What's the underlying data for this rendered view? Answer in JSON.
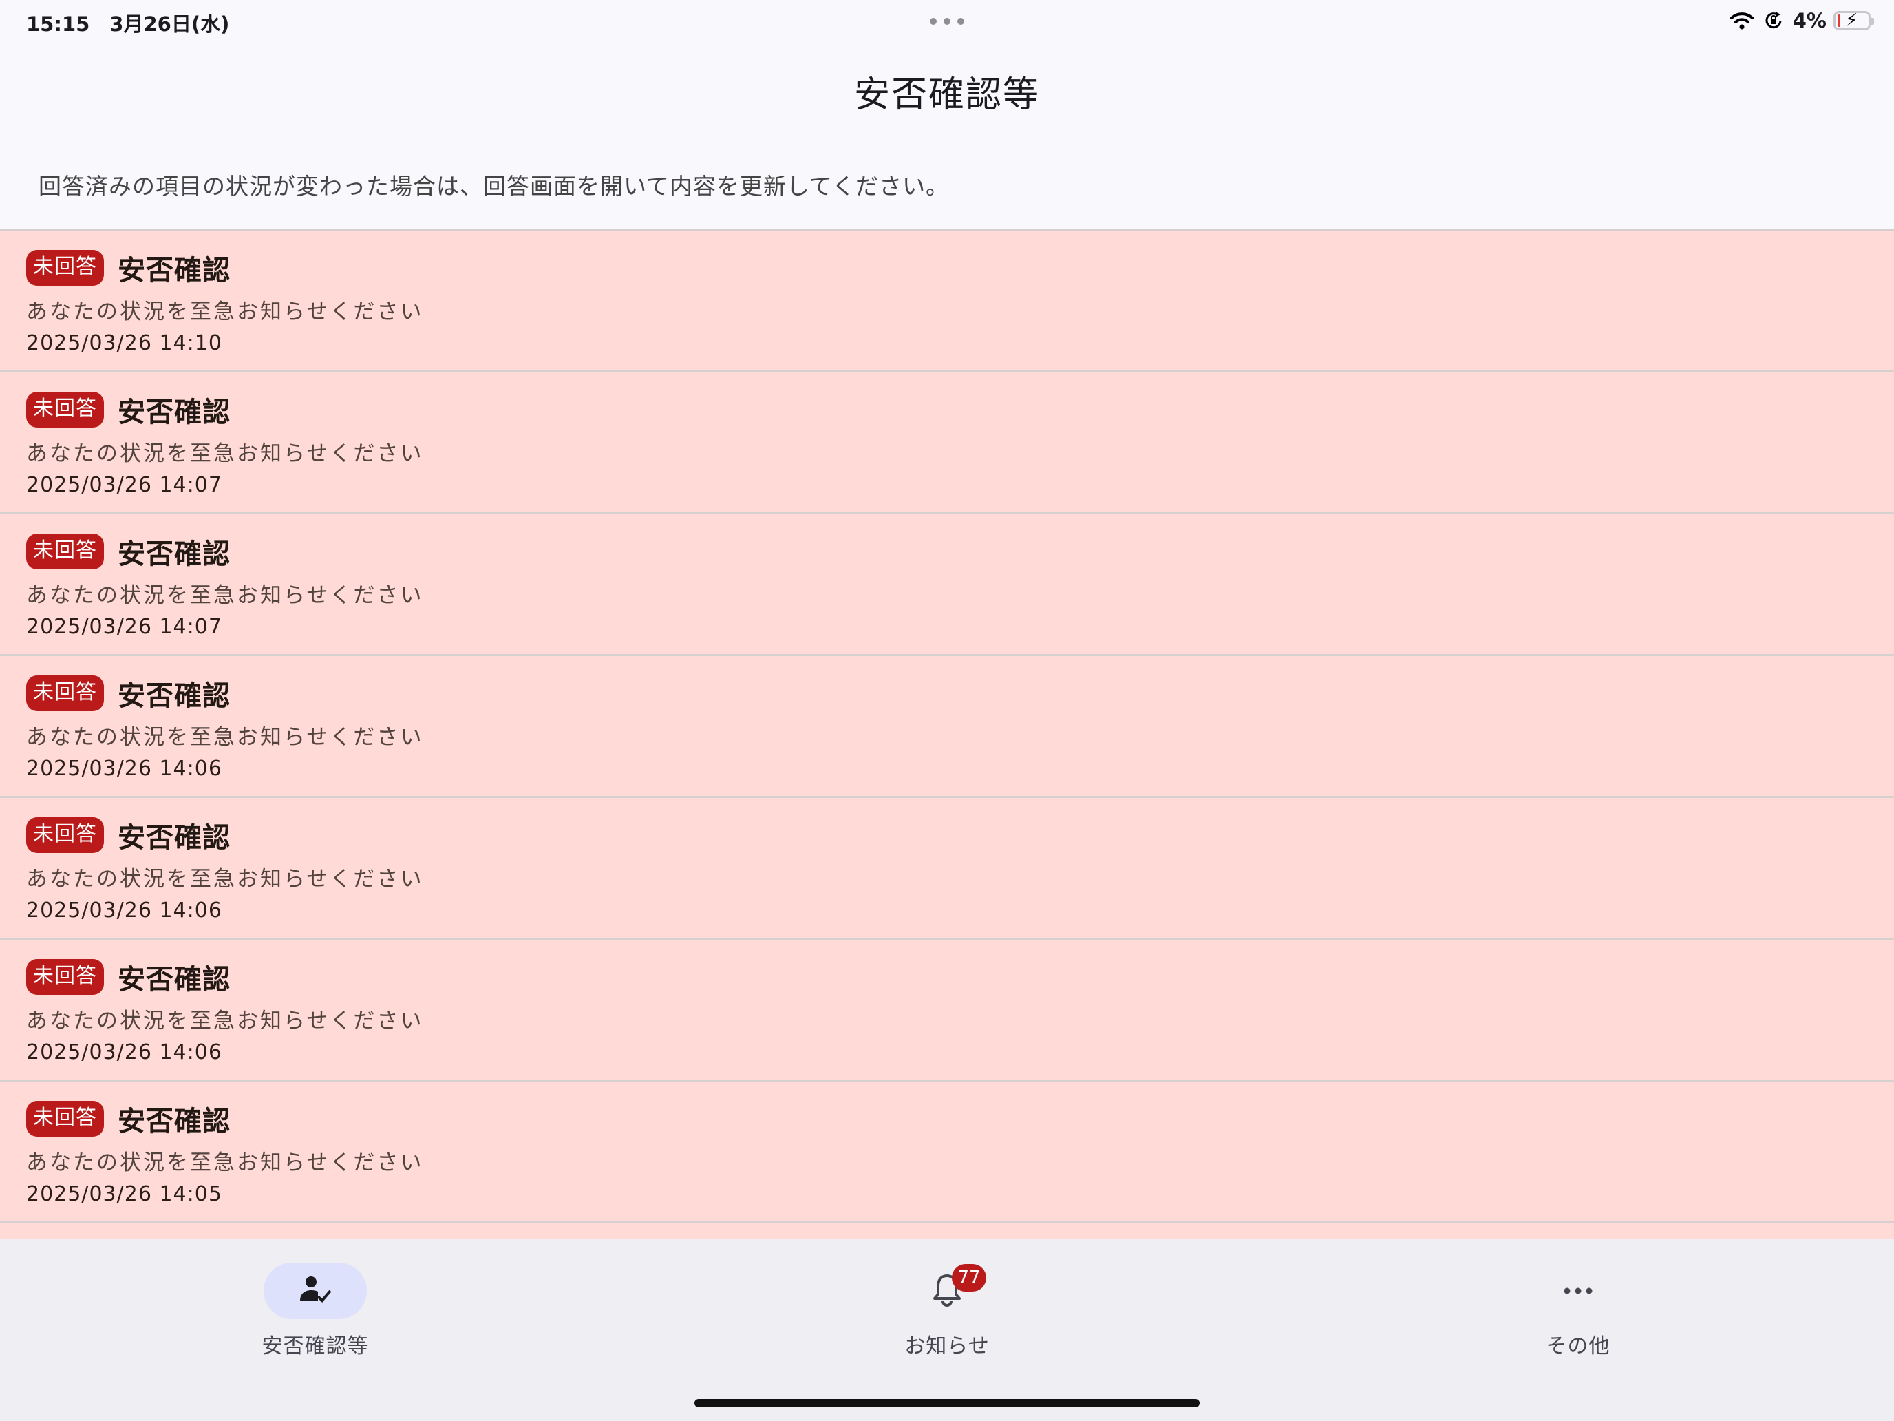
{
  "status_bar": {
    "time": "15:15　3月26日(水)",
    "battery_percent": "4%",
    "icons": [
      "wifi-icon",
      "orientation-lock-icon",
      "battery-icon"
    ]
  },
  "header": {
    "title": "安否確認等"
  },
  "notice": "回答済みの項目の状況が変わった場合は、回答画面を開いて内容を更新してください。",
  "list": {
    "items": [
      {
        "badge": "未回答",
        "title": "安否確認",
        "message": "あなたの状況を至急お知らせください",
        "date": "2025/03/26 14:10"
      },
      {
        "badge": "未回答",
        "title": "安否確認",
        "message": "あなたの状況を至急お知らせください",
        "date": "2025/03/26 14:07"
      },
      {
        "badge": "未回答",
        "title": "安否確認",
        "message": "あなたの状況を至急お知らせください",
        "date": "2025/03/26 14:07"
      },
      {
        "badge": "未回答",
        "title": "安否確認",
        "message": "あなたの状況を至急お知らせください",
        "date": "2025/03/26 14:06"
      },
      {
        "badge": "未回答",
        "title": "安否確認",
        "message": "あなたの状況を至急お知らせください",
        "date": "2025/03/26 14:06"
      },
      {
        "badge": "未回答",
        "title": "安否確認",
        "message": "あなたの状況を至急お知らせください",
        "date": "2025/03/26 14:06"
      },
      {
        "badge": "未回答",
        "title": "安否確認",
        "message": "あなたの状況を至急お知らせください",
        "date": "2025/03/26 14:05"
      }
    ]
  },
  "tabs": [
    {
      "label": "安否確認等",
      "icon": "person-check-icon",
      "active": true
    },
    {
      "label": "お知らせ",
      "icon": "bell-icon",
      "badge": "77",
      "active": false
    },
    {
      "label": "その他",
      "icon": "more-horizontal-icon",
      "active": false
    }
  ],
  "colors": {
    "item_background": "#ffdad6",
    "badge": "#ba1a1a",
    "active_tab": "#dde1fb",
    "tabbar": "#efeef3"
  }
}
